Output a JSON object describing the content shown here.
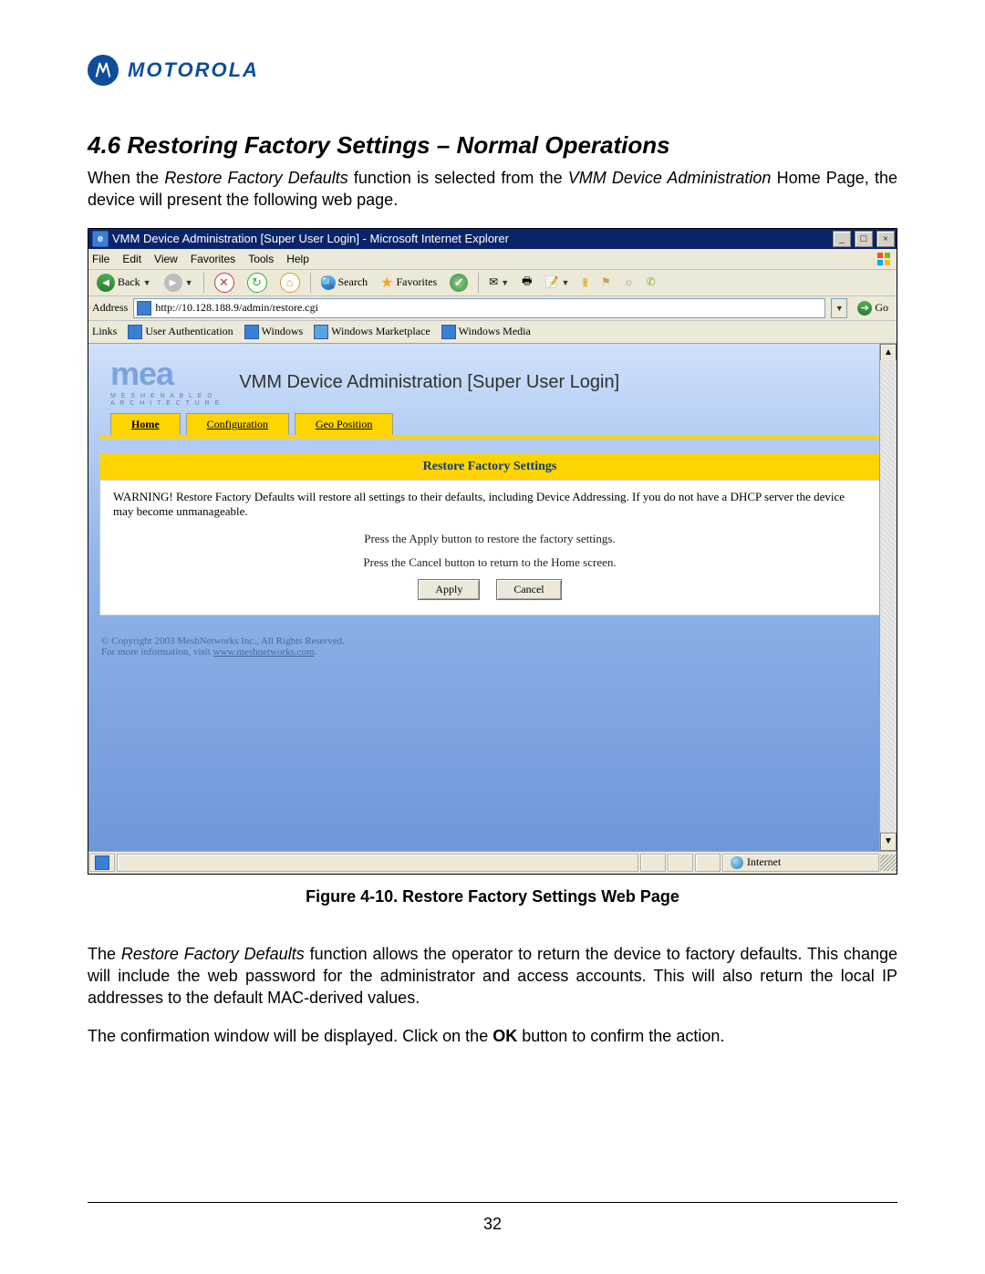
{
  "brand": "MOTOROLA",
  "section_title": "4.6   Restoring Factory Settings – Normal Operations",
  "intro_a": "When the ",
  "intro_it1": "Restore Factory Defaults",
  "intro_b": " function is selected from the ",
  "intro_it2": "VMM Device Administration",
  "intro_c": " Home Page, the device will present the following web page.",
  "figure_caption": "Figure 4-10.   Restore Factory Settings Web Page",
  "para2_a": "The ",
  "para2_it": "Restore Factory Defaults",
  "para2_b": " function allows the operator to return the device to factory defaults. This change will include the web password for the administrator and access accounts. This will also return the local IP addresses to the default MAC-derived values.",
  "para3_a": "The confirmation window will be displayed. Click on the ",
  "para3_b": "OK",
  "para3_c": " button to confirm the action.",
  "page_number": "32",
  "ie": {
    "title": "VMM Device Administration [Super User Login] - Microsoft Internet Explorer",
    "menus": [
      "File",
      "Edit",
      "View",
      "Favorites",
      "Tools",
      "Help"
    ],
    "back": "Back",
    "search": "Search",
    "favorites": "Favorites",
    "address_label": "Address",
    "url": "http://10.128.188.9/admin/restore.cgi",
    "go": "Go",
    "links_label": "Links",
    "links": [
      "User Authentication",
      "Windows",
      "Windows Marketplace",
      "Windows Media"
    ],
    "zone": "Internet"
  },
  "web": {
    "logo_big": "mea",
    "logo_line1": "M E S H   E N A B L E D",
    "logo_line2": "A R C H I T E C T U R E",
    "title": "VMM Device Administration [Super User Login]",
    "tabs": {
      "home": "Home",
      "config": "Configuration",
      "geo": "Geo Position"
    },
    "card_title": "Restore Factory Settings",
    "warning": "WARNING! Restore Factory Defaults will restore all settings to their defaults, including Device Addressing. If you do not have a DHCP server the device may become unmanageable.",
    "line1": "Press the Apply button to restore the factory settings.",
    "line2": "Press the Cancel button to return to the Home screen.",
    "apply": "Apply",
    "cancel": "Cancel",
    "copyright": "© Copyright 2003 MeshNetworks Inc., All Rights Reserved.",
    "moreinfo_a": "For more information, visit ",
    "moreinfo_link": "www.meshnetworks.com",
    "moreinfo_b": "."
  }
}
